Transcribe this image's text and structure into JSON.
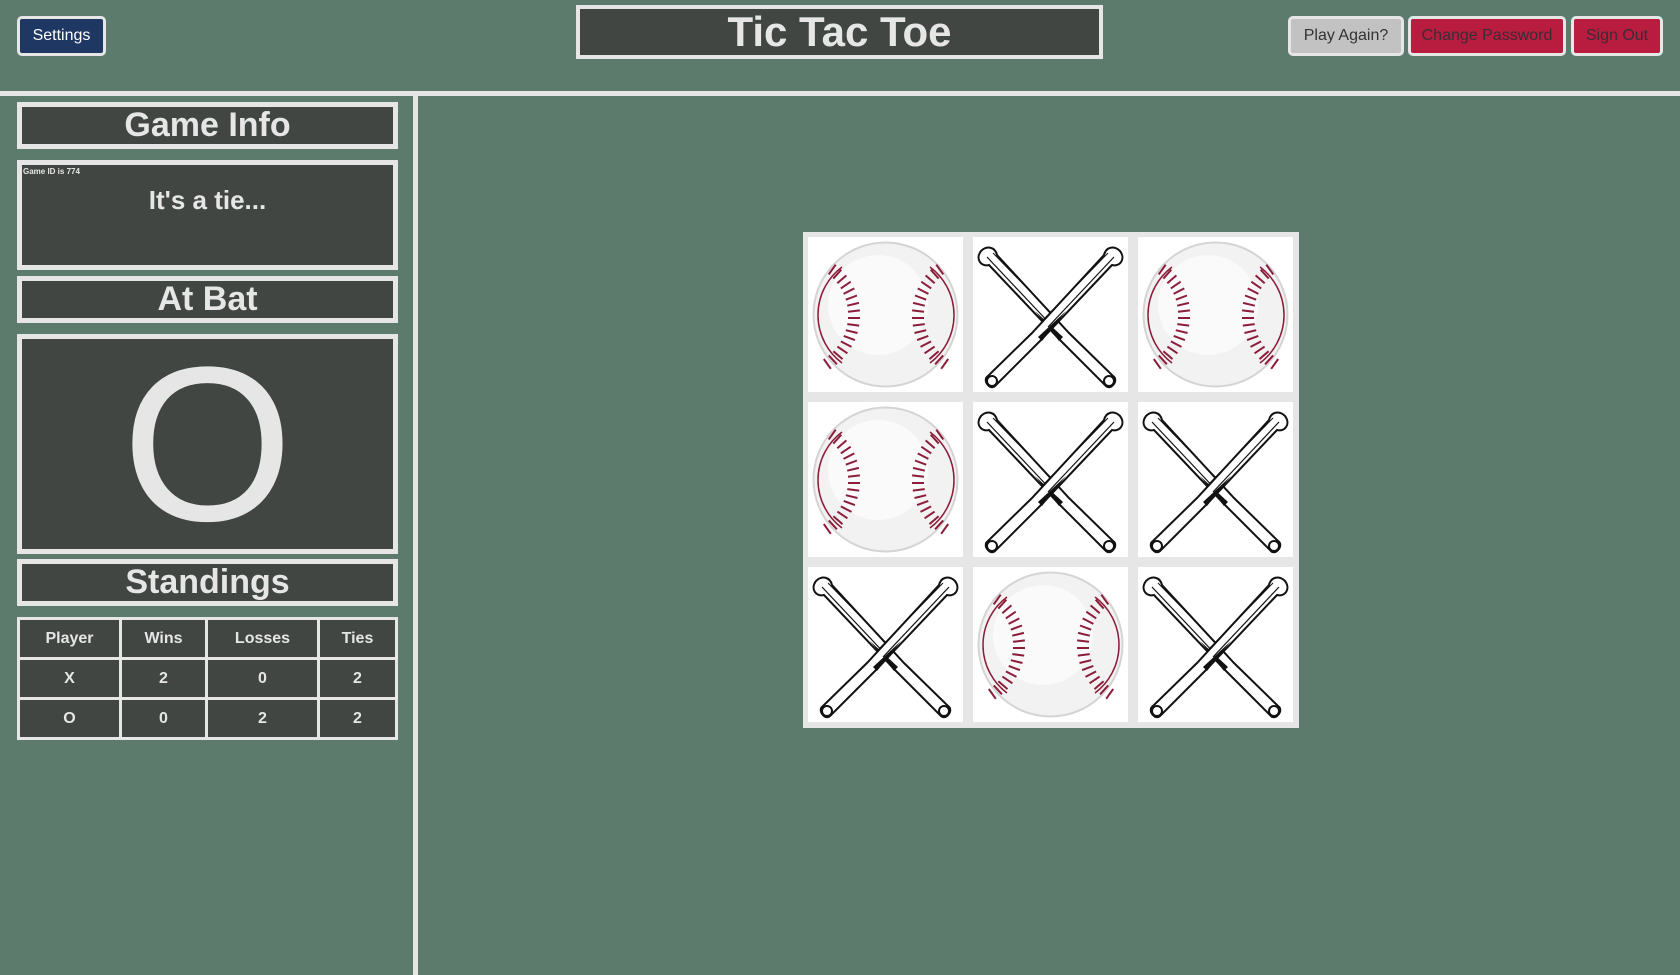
{
  "header": {
    "settings_label": "Settings",
    "title": "Tic Tac Toe",
    "play_again_label": "Play Again?",
    "change_password_label": "Change Password",
    "sign_out_label": "Sign Out"
  },
  "sidebar": {
    "game_info_title": "Game Info",
    "game_id_text": "Game ID is 774",
    "status_message": "It's a tie...",
    "at_bat_title": "At Bat",
    "current_player": "O",
    "standings_title": "Standings",
    "standings": {
      "headers": [
        "Player",
        "Wins",
        "Losses",
        "Ties"
      ],
      "rows": [
        [
          "X",
          "2",
          "0",
          "2"
        ],
        [
          "O",
          "0",
          "2",
          "2"
        ]
      ]
    }
  },
  "board": {
    "cells": [
      "O",
      "X",
      "O",
      "O",
      "X",
      "X",
      "X",
      "O",
      "X"
    ],
    "icons": {
      "X": "crossed-bats-icon",
      "O": "baseball-icon"
    }
  },
  "colors": {
    "background": "#5d7b6c",
    "panel": "#424643",
    "border": "#e6e6e6",
    "settings_button": "#1f3763",
    "danger_button": "#b81c3f",
    "neutral_button": "#c2c2c2",
    "seam": "#8b1d3a"
  }
}
